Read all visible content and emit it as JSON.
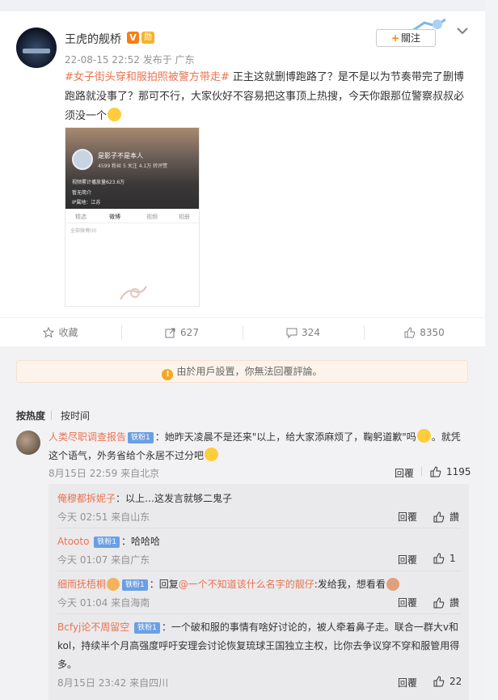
{
  "post": {
    "username": "王虎的舰桥",
    "verified_badge": "V",
    "medal_badge": "勋",
    "timestamp": "22-08-15 22:52",
    "location": "发布于 广东",
    "follow_label": "關注",
    "hashtag": "#女子街头穿和服拍照被警方带走#",
    "text": " 正主这就删博跑路了？是不是以为节奏带完了删博跑路就没事了？那可不行，大家伙好不容易把这事顶上热搜，今天你跟那位警察叔叔必须没一个"
  },
  "post_image": {
    "profile_name": "是影子不是本人",
    "stats": "4599 粉丝   5 关注   4.1万 转评赞",
    "line1": "视频累计播放量623.6万",
    "line2": "暂无简介",
    "line3": "IP属地：江苏",
    "tabs": [
      "精选",
      "微博",
      "视频",
      "相册"
    ],
    "subtext": "全部微博(0)"
  },
  "actions": {
    "collect": "收藏",
    "repost": "627",
    "comment": "324",
    "like": "8350"
  },
  "notice": "由於用戶設置，你無法回覆評論。",
  "sort": {
    "hot": "按热度",
    "time": "按时间"
  },
  "comment": {
    "user": "人类尽职调查报告",
    "badge": "铁粉1",
    "text": "：她昨天凌晨不是还来\"以上，给大家添麻烦了，鞠躬道歉\"吗",
    "text2": "。就凭这个语气，外务省给个永居不过分吧",
    "time": "8月15日 22:59 来自北京",
    "reply_label": "回覆",
    "likes": "1195"
  },
  "replies": [
    {
      "user": "俺穆都拆妮子",
      "text": "：以上…这发言就够二鬼子",
      "time": "今天 02:51 来自山东",
      "reply_label": "回覆",
      "likes": "讚"
    },
    {
      "user": "Atooto",
      "badge": "铁粉1",
      "text": "：哈哈哈",
      "time": "今天 01:07 来自广东",
      "reply_label": "回覆",
      "likes": "1"
    },
    {
      "user": "细雨抚梧桐",
      "badge": "铁粉1",
      "text": "：回复",
      "mention": "@一个不知道该什么名字的靓仔",
      "text_after": ":发给我，想看看",
      "time": "今天 01:04 来自海南",
      "reply_label": "回覆",
      "likes": "讚"
    },
    {
      "user": "Bcfyj论不周留空",
      "badge": "铁粉1",
      "text": "：一个破和服的事情有啥好讨论的，被人牵着鼻子走。联合一群大v和kol，持续半个月高强度呼吁安理会讨论恢复琉球王国独立主权，比你去争议穿不穿和服管用得多。",
      "time": "8月15日 23:42 来自四川",
      "reply_label": "回覆",
      "likes": "22"
    }
  ]
}
